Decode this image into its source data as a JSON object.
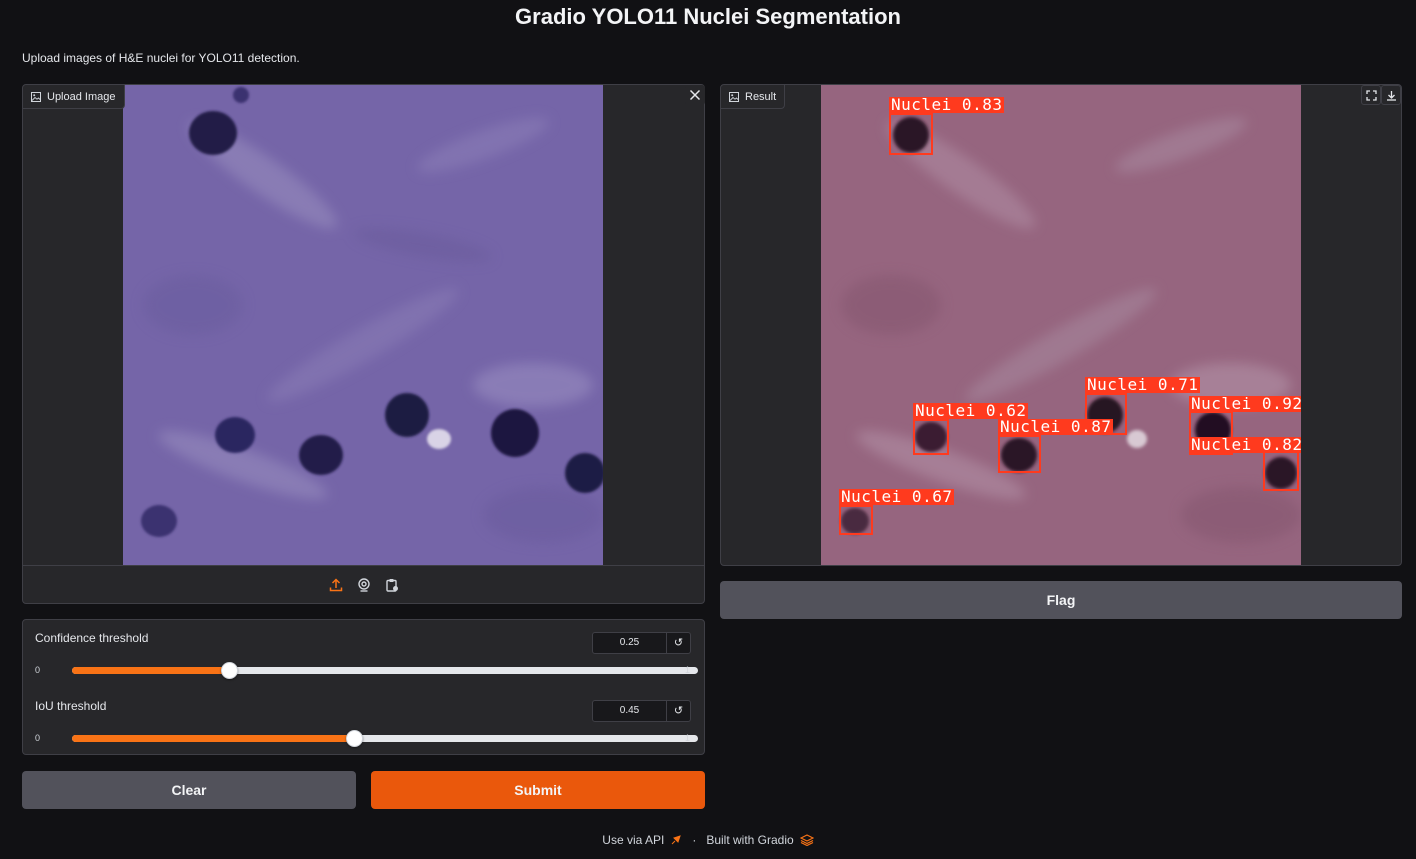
{
  "app": {
    "title": "Gradio YOLO11 Nuclei Segmentation",
    "description": "Upload images of H&E nuclei for YOLO11 detection."
  },
  "input_image": {
    "label": "Upload Image",
    "icons": [
      "image-icon",
      "close-icon",
      "upload-icon",
      "webcam-icon",
      "clipboard-icon"
    ]
  },
  "output_image": {
    "label": "Result",
    "icons": [
      "image-icon",
      "fullscreen-icon",
      "download-icon"
    ],
    "detections": [
      {
        "label": "Nuclei 0.83",
        "class": "Nuclei",
        "confidence": 0.83
      },
      {
        "label": "Nuclei 0.71",
        "class": "Nuclei",
        "confidence": 0.71
      },
      {
        "label": "Nuclei 0.62",
        "class": "Nuclei",
        "confidence": 0.62
      },
      {
        "label": "Nuclei 0.87",
        "class": "Nuclei",
        "confidence": 0.87
      },
      {
        "label": "Nuclei 0.92",
        "class": "Nuclei",
        "confidence": 0.92
      },
      {
        "label": "Nuclei 0.82",
        "class": "Nuclei",
        "confidence": 0.82
      },
      {
        "label": "Nuclei 0.67",
        "class": "Nuclei",
        "confidence": 0.67
      }
    ]
  },
  "sliders": [
    {
      "label": "Confidence threshold",
      "value": "0.25",
      "min": "0",
      "max": "1",
      "fraction": 0.25
    },
    {
      "label": "IoU threshold",
      "value": "0.45",
      "min": "0",
      "max": "1",
      "fraction": 0.45
    }
  ],
  "buttons": {
    "clear": "Clear",
    "submit": "Submit",
    "flag": "Flag"
  },
  "footer": {
    "api": "Use via API",
    "separator": "·",
    "built": "Built with Gradio"
  },
  "colors": {
    "accent": "#f97316",
    "submit": "#ea580c",
    "detection": "#ff3a1e",
    "background": "#111114",
    "panel": "#27272a"
  }
}
